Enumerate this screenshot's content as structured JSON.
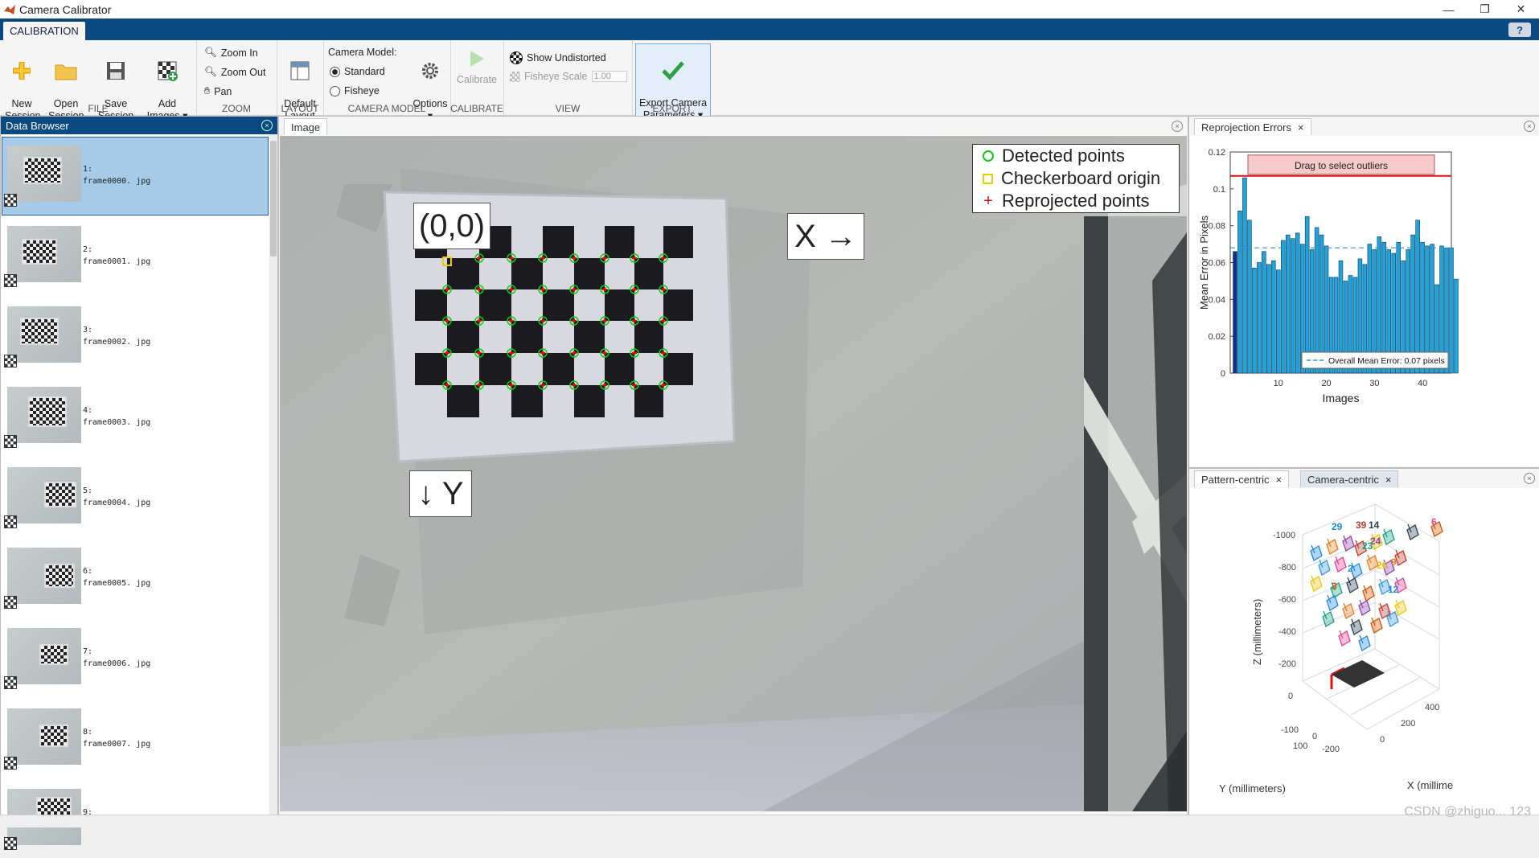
{
  "window": {
    "title": "Camera Calibrator",
    "controls": [
      "—",
      "❐",
      "✕"
    ]
  },
  "toolstrip": {
    "tab": "CALIBRATION",
    "help": "?"
  },
  "ribbon": {
    "file": {
      "title": "FILE",
      "new": "New\nSession",
      "open": "Open\nSession",
      "save": "Save\nSession ▾",
      "add": "Add\nImages ▾"
    },
    "zoom": {
      "title": "ZOOM",
      "zoom_in": "Zoom In",
      "zoom_out": "Zoom Out",
      "pan": "Pan"
    },
    "layout": {
      "title": "LAYOUT",
      "default": "Default\nLayout"
    },
    "camera_model": {
      "title": "CAMERA MODEL",
      "label": "Camera Model:",
      "standard": "Standard",
      "fisheye": "Fisheye",
      "options": "Options\n▾"
    },
    "calibrate": {
      "title": "CALIBRATE",
      "button": "Calibrate"
    },
    "view": {
      "title": "VIEW",
      "show_undistorted": "Show Undistorted",
      "fisheye_scale": "Fisheye Scale",
      "fisheye_value": "1.00"
    },
    "export": {
      "title": "EXPORT",
      "button": "Export Camera\nParameters ▾"
    }
  },
  "data_browser": {
    "title": "Data Browser",
    "items": [
      {
        "index": "1:",
        "file": "frame0000. jpg",
        "selected": true
      },
      {
        "index": "2:",
        "file": "frame0001. jpg"
      },
      {
        "index": "3:",
        "file": "frame0002. jpg"
      },
      {
        "index": "4:",
        "file": "frame0003. jpg"
      },
      {
        "index": "5:",
        "file": "frame0004. jpg"
      },
      {
        "index": "6:",
        "file": "frame0005. jpg"
      },
      {
        "index": "7:",
        "file": "frame0006. jpg"
      },
      {
        "index": "8:",
        "file": "frame0007. jpg"
      },
      {
        "index": "9:",
        "file": ""
      }
    ]
  },
  "image_panel": {
    "tab": "Image",
    "legend": {
      "detected": "Detected points",
      "origin": "Checkerboard origin",
      "reprojected": "Reprojected points"
    },
    "origin_label": "(0,0)",
    "x_label": "X →",
    "y_label": "↓ Y"
  },
  "reprojection_panel": {
    "tab": "Reprojection Errors",
    "close": "×",
    "drag_label": "Drag to select outliers",
    "overall": "Overall Mean Error: 0.07 pixels"
  },
  "extrinsics_panel": {
    "tabs": [
      "Pattern-centric",
      "Camera-centric"
    ],
    "z_label": "Z (millimeters)",
    "y_label": "Y (millimeters)",
    "x_label": "X (millime",
    "z_ticks": [
      "-1000",
      "-800",
      "-600",
      "-400",
      "-200",
      "0"
    ],
    "y_ticks": [
      "-100",
      "0",
      "100",
      "-200"
    ],
    "x_ticks": [
      "0",
      "200",
      "400"
    ],
    "view_labels": [
      "29",
      "39",
      "14",
      "6",
      "24",
      "23",
      "2",
      "9",
      "26",
      "3",
      "12"
    ]
  },
  "chart_data": {
    "type": "bar",
    "title": "",
    "xlabel": "Images",
    "ylabel": "Mean Error in Pixels",
    "ylim": [
      0,
      0.12
    ],
    "xlim": [
      0,
      46
    ],
    "xticks": [
      10,
      20,
      30,
      40
    ],
    "yticks": [
      0,
      0.02,
      0.04,
      0.06,
      0.08,
      0.1,
      0.12
    ],
    "mean_error": 0.068,
    "outlier_threshold": 0.107,
    "selected_index": 1,
    "values": [
      0.066,
      0.088,
      0.106,
      0.083,
      0.057,
      0.06,
      0.066,
      0.059,
      0.061,
      0.056,
      0.072,
      0.075,
      0.073,
      0.076,
      0.07,
      0.085,
      0.067,
      0.079,
      0.075,
      0.069,
      0.052,
      0.052,
      0.061,
      0.05,
      0.053,
      0.052,
      0.062,
      0.059,
      0.07,
      0.067,
      0.074,
      0.071,
      0.067,
      0.065,
      0.071,
      0.061,
      0.067,
      0.075,
      0.083,
      0.071,
      0.069,
      0.07,
      0.048,
      0.069,
      0.068,
      0.068,
      0.051
    ],
    "legend": "Overall Mean Error: 0.07 pixels",
    "legend_position": "bottom-right"
  },
  "watermark": "CSDN @zhiguo... 123",
  "colors": {
    "toolstrip_blue": "#0b4a80",
    "bar_fill": "#1fa3d9",
    "selected_bar": "#10308f",
    "threshold": "#e01010",
    "detected": "#11cc11",
    "origin": "#e8d000",
    "reprojected": "#d01010"
  }
}
